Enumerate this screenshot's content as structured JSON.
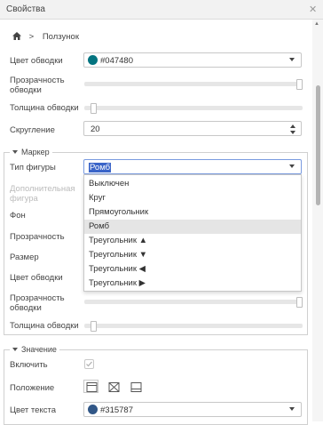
{
  "window": {
    "title": "Свойства",
    "close_glyph": "✕"
  },
  "breadcrumb": {
    "home_icon": "home-icon",
    "separator": ">",
    "current": "Ползунок"
  },
  "outline": {
    "color_label": "Цвет обводки",
    "color_value": "#047480",
    "color_hex": "#047480",
    "opacity_label": "Прозрачность обводки",
    "opacity_level": 1.0,
    "width_label": "Толщина обводки",
    "width_level": 0.03,
    "rounding_label": "Скругление",
    "rounding_value": "20"
  },
  "marker": {
    "legend": "Маркер",
    "shape_label": "Тип фигуры",
    "shape_value": "Ромб",
    "extra_shape_label": "Дополнительная фигура",
    "bg_label": "Фон",
    "opacity_label": "Прозрачность",
    "size_label": "Размер",
    "outline_color_label": "Цвет обводки",
    "outline_opacity_label": "Прозрачность обводки",
    "outline_opacity_level": 1.0,
    "outline_width_label": "Толщина обводки",
    "outline_width_level": 0.03,
    "options": [
      "Выключен",
      "Круг",
      "Прямоугольник",
      "Ромб",
      "Треугольник ▲",
      "Треугольник ▼",
      "Треугольник ◀",
      "Треугольник ▶"
    ],
    "selected_index": 3
  },
  "value": {
    "legend": "Значение",
    "enable_label": "Включить",
    "enabled": true,
    "position_label": "Положение",
    "text_color_label": "Цвет текста",
    "text_color_value": "#315787",
    "text_color_hex": "#315787"
  }
}
